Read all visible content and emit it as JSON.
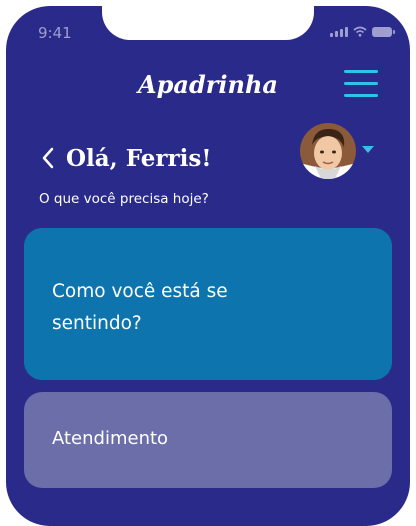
{
  "status_bar": {
    "time": "9:41"
  },
  "header": {
    "brand": "Apadrinha"
  },
  "greeting": {
    "title": "Olá, Ferris!",
    "subtitle": "O que você precisa hoje?"
  },
  "cards": [
    {
      "label": "Como você está se sentindo?"
    },
    {
      "label": "Atendimento"
    }
  ],
  "icons": {
    "back": "chevron-left-icon",
    "menu": "hamburger-menu-icon",
    "profile": "avatar",
    "dropdown": "caret-down-icon"
  },
  "colors": {
    "background": "#2a2a8a",
    "accent": "#2ec4e6",
    "card_primary": "#0e74ad",
    "card_secondary": "#6b6ea8"
  }
}
